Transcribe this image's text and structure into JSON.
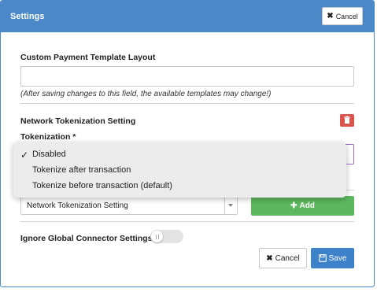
{
  "header": {
    "title": "Settings",
    "cancel_label": "Cancel"
  },
  "payment_template": {
    "label": "Custom Payment Template Layout",
    "value": "",
    "hint": "(After saving changes to this field, the available templates may change!)"
  },
  "network_tokenization": {
    "section_label": "Network Tokenization Setting",
    "field_label": "Tokenization *",
    "options": [
      {
        "label": "Disabled",
        "selected": true
      },
      {
        "label": "Tokenize after transaction",
        "selected": false
      },
      {
        "label": "Tokenize before transaction (default)",
        "selected": false
      }
    ]
  },
  "add_setting": {
    "select_value": "Network Tokenization Setting",
    "add_label": "Add"
  },
  "ignore_global": {
    "label": "Ignore Global Connector Settings",
    "enabled": false
  },
  "footer": {
    "cancel_label": "Cancel",
    "save_label": "Save"
  },
  "colors": {
    "primary": "#4a88c8",
    "danger": "#d9534f",
    "success": "#5cb85c",
    "save": "#3f82cc"
  }
}
